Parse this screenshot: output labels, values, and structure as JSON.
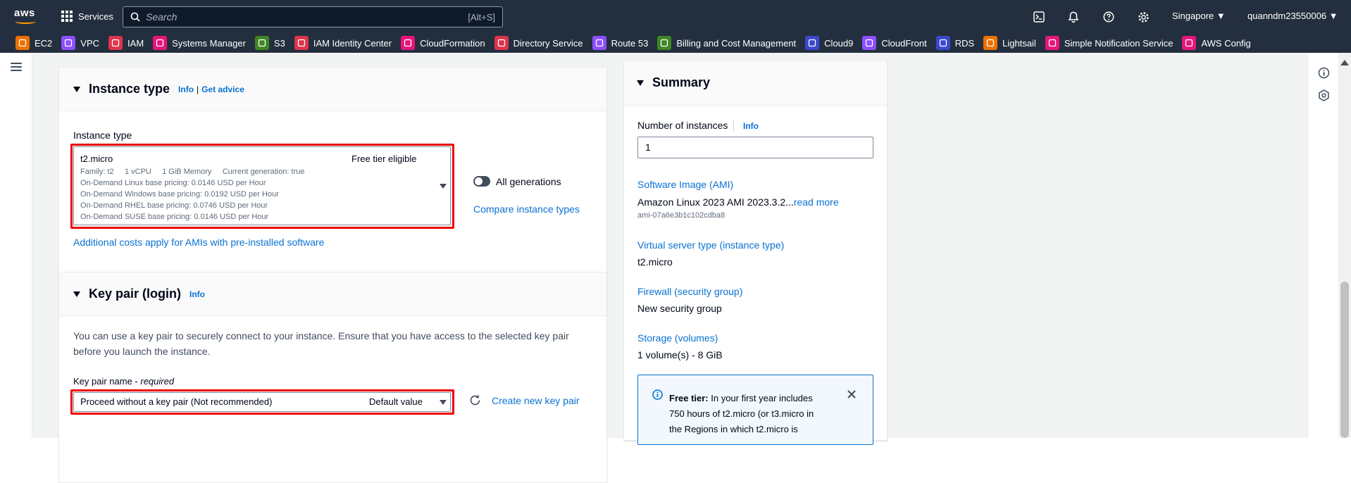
{
  "topnav": {
    "logo_text": "aws",
    "services_label": "Services",
    "search_placeholder": "Search",
    "search_shortcut": "[Alt+S]",
    "region": "Singapore ▼",
    "account": "quanndm23550006 ▼"
  },
  "favorites": [
    {
      "label": "EC2",
      "color": "#ed7100",
      "icon": "ec2-icon"
    },
    {
      "label": "VPC",
      "color": "#8c4fff",
      "icon": "vpc-icon"
    },
    {
      "label": "IAM",
      "color": "#dd344c",
      "icon": "iam-icon"
    },
    {
      "label": "Systems Manager",
      "color": "#e7157b",
      "icon": "systems-manager-icon"
    },
    {
      "label": "S3",
      "color": "#3f8624",
      "icon": "s3-icon"
    },
    {
      "label": "IAM Identity Center",
      "color": "#dd344c",
      "icon": "iam-identity-center-icon"
    },
    {
      "label": "CloudFormation",
      "color": "#e7157b",
      "icon": "cloudformation-icon"
    },
    {
      "label": "Directory Service",
      "color": "#dd344c",
      "icon": "directory-service-icon"
    },
    {
      "label": "Route 53",
      "color": "#8c4fff",
      "icon": "route53-icon"
    },
    {
      "label": "Billing and Cost Management",
      "color": "#3f8624",
      "icon": "billing-icon"
    },
    {
      "label": "Cloud9",
      "color": "#3b48cc",
      "icon": "cloud9-icon"
    },
    {
      "label": "CloudFront",
      "color": "#8c4fff",
      "icon": "cloudfront-icon"
    },
    {
      "label": "RDS",
      "color": "#3b48cc",
      "icon": "rds-icon"
    },
    {
      "label": "Lightsail",
      "color": "#ed7100",
      "icon": "lightsail-icon"
    },
    {
      "label": "Simple Notification Service",
      "color": "#e7157b",
      "icon": "sns-icon"
    },
    {
      "label": "AWS Config",
      "color": "#e7157b",
      "icon": "aws-config-icon"
    }
  ],
  "instance_type": {
    "title": "Instance type",
    "info": "Info",
    "separator": "|",
    "advice": "Get advice",
    "field_label": "Instance type",
    "selected": "t2.micro",
    "badge": "Free tier eligible",
    "details_line": "Family: t2     1 vCPU     1 GiB Memory     Current generation: true",
    "pricing": [
      "On-Demand Linux base pricing: 0.0146 USD per Hour",
      "On-Demand Windows base pricing: 0.0192 USD per Hour",
      "On-Demand RHEL base pricing: 0.0746 USD per Hour",
      "On-Demand SUSE base pricing: 0.0146 USD per Hour"
    ],
    "all_generations": "All generations",
    "compare": "Compare instance types",
    "additional_costs": "Additional costs apply for AMIs with pre-installed software"
  },
  "key_pair": {
    "title": "Key pair (login)",
    "info": "Info",
    "description": "You can use a key pair to securely connect to your instance. Ensure that you have access to the selected key pair before you launch the instance.",
    "name_label": "Key pair name - ",
    "required": "required",
    "selected": "Proceed without a key pair (Not recommended)",
    "default_value": "Default value",
    "create_new": "Create new key pair"
  },
  "summary": {
    "title": "Summary",
    "instances_label": "Number of instances",
    "info": "Info",
    "instances_value": "1",
    "ami_label": "Software Image (AMI)",
    "ami_value": "Amazon Linux 2023 AMI 2023.3.2...",
    "read_more": "read more",
    "ami_id": "ami-07a6e3b1c102cdba8",
    "server_type_label": "Virtual server type (instance type)",
    "server_type_value": "t2.micro",
    "firewall_label": "Firewall (security group)",
    "firewall_value": "New security group",
    "storage_label": "Storage (volumes)",
    "storage_value": "1 volume(s) - 8 GiB",
    "free_tier_bold": "Free tier:",
    "free_tier_text_1": " In your first year includes",
    "free_tier_text_2": "750 hours of t2.micro (or t3.micro in",
    "free_tier_text_3": "the Regions in which t2.micro is"
  }
}
